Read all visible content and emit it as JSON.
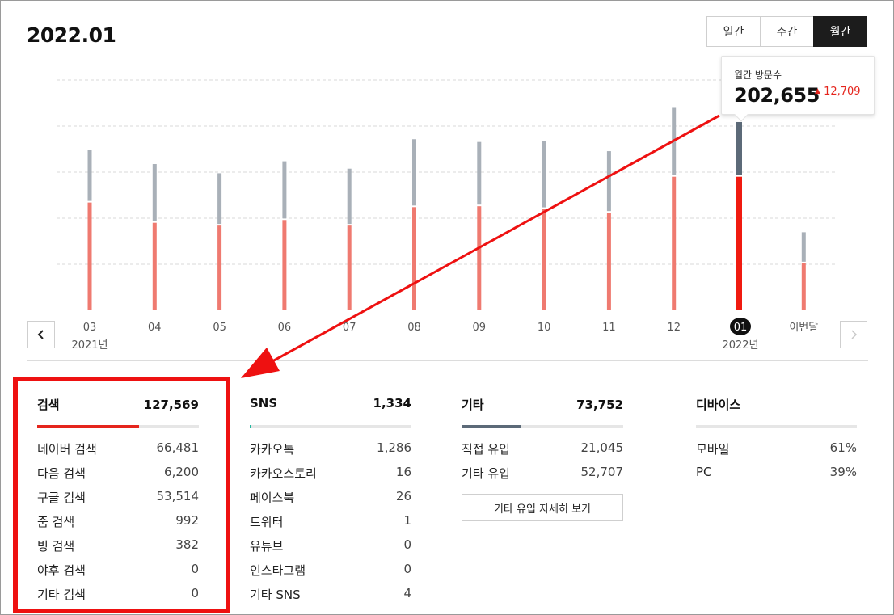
{
  "page": {
    "title": "2022.01"
  },
  "period_tabs": [
    {
      "label": "일간",
      "active": false
    },
    {
      "label": "주간",
      "active": false
    },
    {
      "label": "월간",
      "active": true
    }
  ],
  "tooltip": {
    "label": "월간 방문수",
    "value": "202,655",
    "change": "12,709"
  },
  "colors": {
    "accent": "#e5251d",
    "bar_red": "#ef7a70",
    "bar_gray": "#a9b0b8",
    "current_red": "#f01a10",
    "current_gray": "#5c6a78",
    "annotation": "#ee1111"
  },
  "chart_data": {
    "type": "bar",
    "stacked": true,
    "categories": [
      "03",
      "04",
      "05",
      "06",
      "07",
      "08",
      "09",
      "10",
      "11",
      "12",
      "01",
      "이번달"
    ],
    "year_labels": [
      {
        "at": "03",
        "text": "2021년"
      },
      {
        "at": "01",
        "text": "2022년"
      }
    ],
    "selected": "01",
    "series": [
      {
        "values": [
          117000,
          95000,
          92000,
          98000,
          92000,
          112000,
          113000,
          110000,
          106000,
          145000,
          145000,
          51000
        ]
      },
      {
        "values": [
          55000,
          62000,
          55000,
          62000,
          60000,
          72000,
          68000,
          72000,
          65000,
          73000,
          57655,
          32000
        ]
      }
    ],
    "ylim": [
      0,
      250000
    ],
    "grid": true
  },
  "stats": {
    "search": {
      "title": "검색",
      "total": "127,569",
      "share": 0.63,
      "rows": [
        {
          "label": "네이버 검색",
          "value": "66,481"
        },
        {
          "label": "다음 검색",
          "value": "6,200"
        },
        {
          "label": "구글 검색",
          "value": "53,514"
        },
        {
          "label": "줌 검색",
          "value": "992"
        },
        {
          "label": "빙 검색",
          "value": "382"
        },
        {
          "label": "야후 검색",
          "value": "0"
        },
        {
          "label": "기타 검색",
          "value": "0"
        }
      ]
    },
    "sns": {
      "title": "SNS",
      "total": "1,334",
      "share": 0.01,
      "rows": [
        {
          "label": "카카오톡",
          "value": "1,286"
        },
        {
          "label": "카카오스토리",
          "value": "16"
        },
        {
          "label": "페이스북",
          "value": "26"
        },
        {
          "label": "트위터",
          "value": "1"
        },
        {
          "label": "유튜브",
          "value": "0"
        },
        {
          "label": "인스타그램",
          "value": "0"
        },
        {
          "label": "기타 SNS",
          "value": "4"
        }
      ]
    },
    "etc": {
      "title": "기타",
      "total": "73,752",
      "share": 0.37,
      "rows": [
        {
          "label": "직접 유입",
          "value": "21,045"
        },
        {
          "label": "기타 유입",
          "value": "52,707"
        }
      ],
      "detail_button": "기타 유입 자세히 보기"
    },
    "device": {
      "title": "디바이스",
      "rows": [
        {
          "label": "모바일",
          "value": "61%"
        },
        {
          "label": "PC",
          "value": "39%"
        }
      ]
    }
  }
}
